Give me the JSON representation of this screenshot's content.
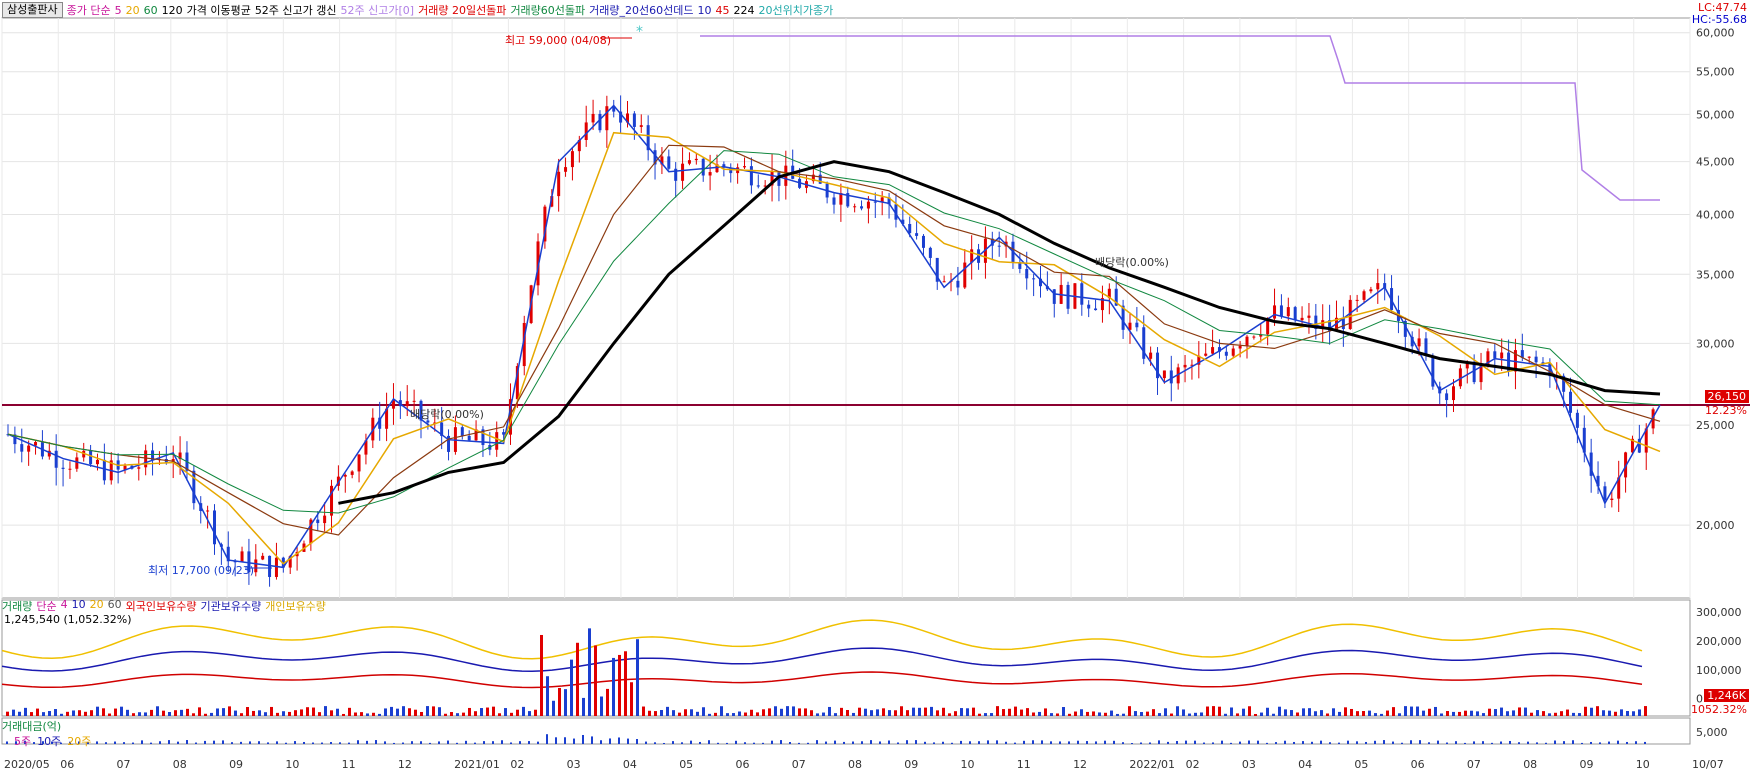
{
  "legend": {
    "stock_name": "삼성출판사",
    "price_ma_label": "종가 단순",
    "ma_periods": [
      "5",
      "20",
      "60",
      "120"
    ],
    "price_avg_label": "가격 이동평균",
    "week52_label": "52주 신고가 갱신",
    "week52_count": "52주 신고가[0]",
    "vol_cross20": "거래량 20일선돌파",
    "vol_cross60": "거래량60선돌파",
    "vol_dead": "거래량_20선60선데드",
    "dead_params": [
      "10",
      "45",
      "224"
    ],
    "ma20_position": "20선위치가종가"
  },
  "colors": {
    "ma5": "#c8159a",
    "ma20": "#e6a800",
    "ma60": "#118840",
    "ma120": "#000000",
    "up": "#e00000",
    "down": "#1a3fd0",
    "accent_line": "#8b0030",
    "new_high": "#4cc7c7",
    "week52_line": "#b07fe6",
    "foreign": "#d00000",
    "inst": "#1a1ab0",
    "indiv": "#f0c000"
  },
  "header_right": {
    "lc": "LC:47.74",
    "hc": "HC:-55.68"
  },
  "price_axis": {
    "ticks": [
      "60,000",
      "55,000",
      "50,000",
      "45,000",
      "40,000",
      "35,000",
      "30,000",
      "25,000",
      "20,000"
    ],
    "current_price": "26,150",
    "current_pct": "12.23%",
    "reference_price": 26150,
    "scale": "log"
  },
  "annotations": {
    "high": "최고 59,000 (04/08)",
    "low": "최저 17,700 (09/23)",
    "label_a": "배당락(0.00%)",
    "label_b": "배당락(0.00%)"
  },
  "volume_panel": {
    "legend_label": "거래량",
    "ma_label": "단순",
    "ma_periods": [
      "4",
      "10",
      "20",
      "60"
    ],
    "foreign": "외국인보유수량",
    "inst": "기관보유수량",
    "indiv": "개인보유수량",
    "stat": "1,245,540 (1,052.32%)",
    "ticks": [
      "300,000",
      "200,000",
      "100,000",
      "0"
    ],
    "current_tag": "1,246K",
    "current_pct": "1052.32%"
  },
  "amount_panel": {
    "legend_label": "거래대금(억)",
    "ma_labels": [
      "5주",
      "10주",
      "20주"
    ],
    "tick": "5,000"
  },
  "x_axis": {
    "labels": [
      "2020/05",
      "06",
      "07",
      "08",
      "09",
      "10",
      "11",
      "12",
      "2021/01",
      "02",
      "03",
      "04",
      "05",
      "06",
      "07",
      "08",
      "09",
      "10",
      "11",
      "12",
      "2022/01",
      "02",
      "03",
      "04",
      "05",
      "06",
      "07",
      "08",
      "09",
      "10",
      "10/07"
    ]
  },
  "chart_data": {
    "type": "line",
    "scale": "log",
    "x_months": [
      "2020/05",
      "06",
      "07",
      "08",
      "09",
      "10",
      "11",
      "12",
      "2021/01",
      "02",
      "03",
      "04",
      "05",
      "06",
      "07",
      "08",
      "09",
      "10",
      "11",
      "12",
      "2022/01",
      "02",
      "03",
      "04",
      "05",
      "06",
      "07",
      "08",
      "09",
      "10"
    ],
    "close": [
      24500,
      23200,
      22500,
      23500,
      18500,
      18200,
      22000,
      26500,
      24200,
      24000,
      45000,
      51000,
      44000,
      44500,
      43500,
      42000,
      41000,
      34000,
      38000,
      33500,
      33000,
      27500,
      29500,
      32000,
      31000,
      34000,
      27000,
      29000,
      28500,
      21000,
      26150
    ],
    "ma120": [
      null,
      null,
      null,
      null,
      null,
      null,
      21000,
      21500,
      22500,
      23000,
      25500,
      30000,
      35000,
      39000,
      43500,
      45000,
      44000,
      42000,
      40000,
      37500,
      35500,
      34000,
      32500,
      31500,
      31000,
      30000,
      29000,
      28500,
      28000,
      27000,
      26800
    ],
    "y_range": [
      17000,
      62000
    ],
    "high_point": {
      "date": "04/08",
      "value": 59000
    },
    "low_point": {
      "date": "09/23",
      "value": 17700
    }
  }
}
